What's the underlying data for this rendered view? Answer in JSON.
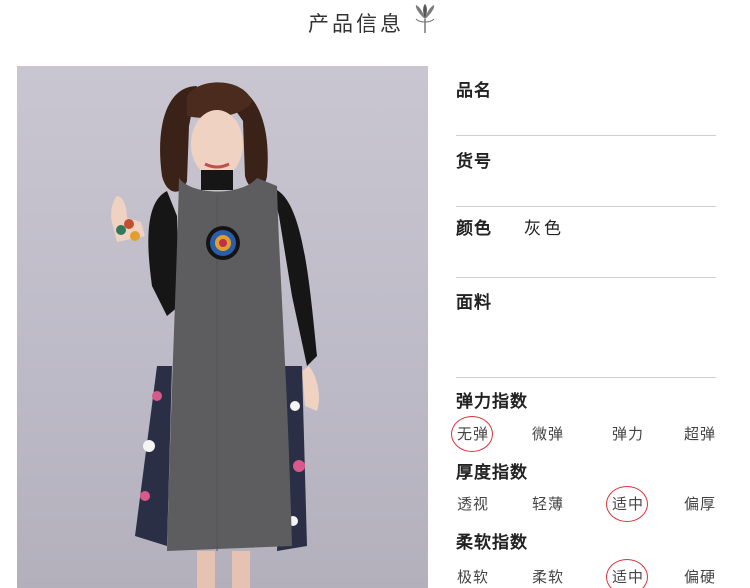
{
  "header": {
    "title": "产品信息",
    "icon": "lotus-icon"
  },
  "fields": [
    {
      "label": "品名",
      "value": ""
    },
    {
      "label": "货号",
      "value": ""
    },
    {
      "label": "颜色",
      "value": "灰色"
    },
    {
      "label": "面料",
      "value": ""
    }
  ],
  "indices": [
    {
      "title": "弹力指数",
      "options": [
        "无弹",
        "微弹",
        "弹力",
        "超弹"
      ],
      "selected": 0
    },
    {
      "title": "厚度指数",
      "options": [
        "透视",
        "轻薄",
        "适中",
        "偏厚"
      ],
      "selected": 2
    },
    {
      "title": "柔软指数",
      "options": [
        "极软",
        "柔软",
        "适中",
        "偏硬"
      ],
      "selected": 2
    }
  ],
  "colors": {
    "dress": "#5d5d60",
    "sweater": "#161616",
    "background": "#c3c0cb",
    "highlight": "#d9323a"
  }
}
